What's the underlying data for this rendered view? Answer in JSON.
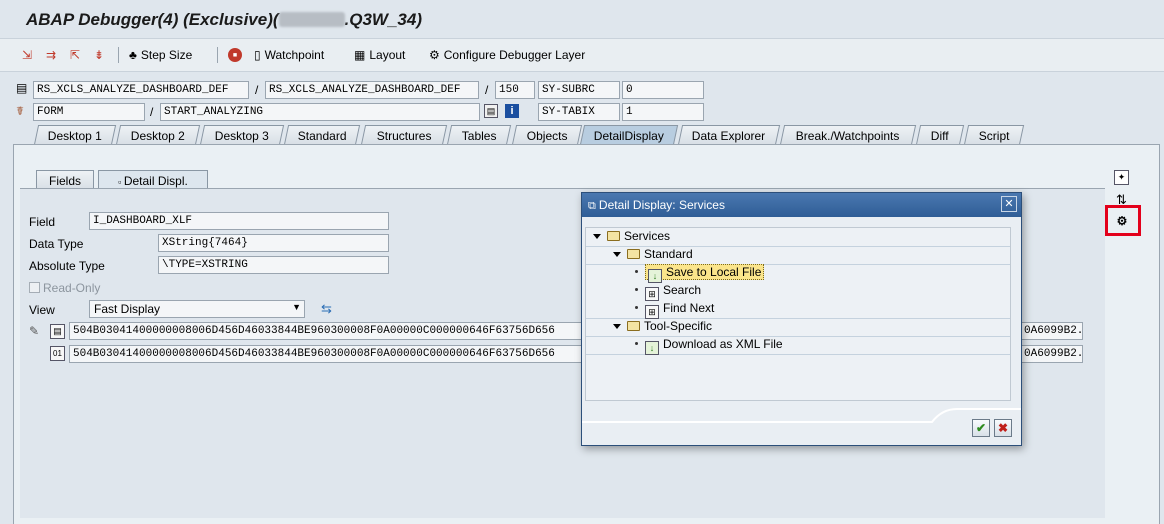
{
  "window": {
    "title_prefix": "ABAP Debugger(4)  (Exclusive)(",
    "title_suffix": ".Q3W_34)"
  },
  "toolbar": {
    "step_size": "Step Size",
    "watchpoint": "Watchpoint",
    "layout": "Layout",
    "configure": "Configure Debugger Layer"
  },
  "context": {
    "program1": "RS_XCLS_ANALYZE_DASHBOARD_DEF",
    "program2": "RS_XCLS_ANALYZE_DASHBOARD_DEF",
    "line": "150",
    "sy_subrc_label": "SY-SUBRC",
    "sy_subrc_value": "0",
    "block_type": "FORM",
    "block_name": "START_ANALYZING",
    "sy_tabix_label": "SY-TABIX",
    "sy_tabix_value": "1"
  },
  "tabs": [
    "Desktop 1",
    "Desktop 2",
    "Desktop 3",
    "Standard",
    "Structures",
    "Tables",
    "Objects",
    "DetailDisplay",
    "Data Explorer",
    "Break./Watchpoints",
    "Diff",
    "Script"
  ],
  "subtabs": {
    "fields": "Fields",
    "detail": "Detail Displ."
  },
  "detail": {
    "field_label": "Field",
    "field_value": "I_DASHBOARD_XLF",
    "datatype_label": "Data Type",
    "datatype_value": "XString{7464}",
    "abstype_label": "Absolute Type",
    "abstype_value": "\\TYPE=XSTRING",
    "readonly_label": "Read-Only",
    "view_label": "View",
    "view_value": "Fast Display",
    "hex_line1_left": "504B03041400000008006D456D46033844BE960300008F0A00000C000000646F63756D656",
    "hex_line1_right": "0A6099B2..",
    "hex_line2_left": "504B03041400000008006D456D46033844BE960300008F0A00000C000000646F63756D656",
    "hex_line2_right": "0A6099B2.."
  },
  "dialog": {
    "title": "Detail Display: Services",
    "close": "✕",
    "root": "Services",
    "standard": "Standard",
    "save": "Save to Local File",
    "search": "Search",
    "find_next": "Find Next",
    "tool_specific": "Tool-Specific",
    "download_xml": "Download as XML File"
  },
  "accent": "#e3001b"
}
